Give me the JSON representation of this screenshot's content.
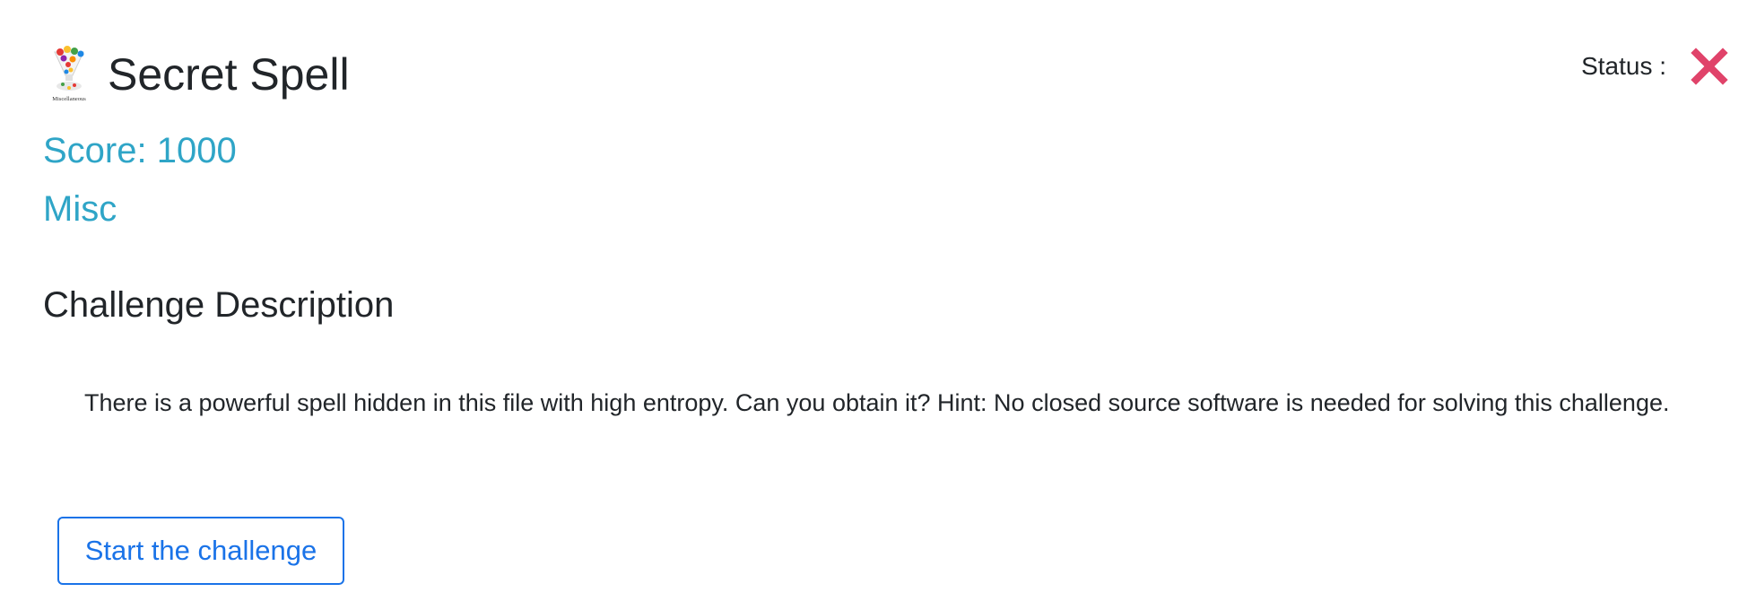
{
  "challenge": {
    "logo_caption": "Miscellaneous",
    "logo_icon": "miscellaneous-icon",
    "title": "Secret Spell",
    "score": "Score: 1000",
    "category": "Misc"
  },
  "status": {
    "label": "Status :",
    "icon": "cross-icon",
    "color": "#e0436a"
  },
  "description": {
    "heading": "Challenge Description",
    "text": "There is a powerful spell hidden in this file with high entropy. Can you obtain it?  Hint: No closed source software is needed for solving this challenge."
  },
  "actions": {
    "start_label": "Start the challenge"
  },
  "colors": {
    "accent": "#2fa5c7",
    "button": "#1a73e8",
    "text": "#212529"
  }
}
